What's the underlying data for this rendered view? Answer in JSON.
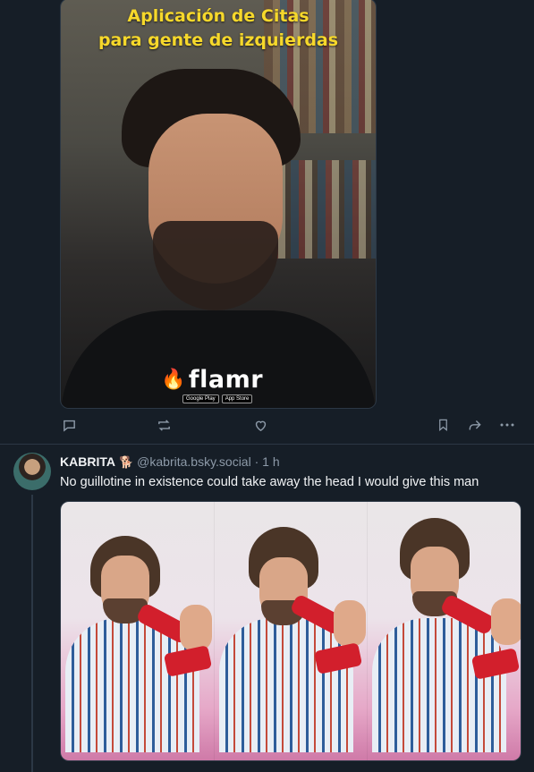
{
  "post1": {
    "image": {
      "title_line1": "Aplicación de Citas",
      "title_line2": "para gente de izquierdas",
      "brand": "flamr",
      "badge_google": "Google Play",
      "badge_apple": "App Store"
    },
    "actions": {
      "reply_icon": "reply-icon",
      "repost_icon": "repost-icon",
      "like_icon": "heart-icon",
      "bookmark_icon": "bookmark-icon",
      "share_icon": "share-icon",
      "more_icon": "more-icon"
    }
  },
  "post2": {
    "author": "KABRITA",
    "emoji": "🐕",
    "handle": "@kabrita.bsky.social",
    "separator": "·",
    "time": "1 h",
    "text": "No guillotine in existence could take away the head I would give this man"
  },
  "colors": {
    "background": "#161e27",
    "text": "#f1f3f5",
    "muted": "#8d9aa8",
    "border": "#2c3845",
    "title_yellow": "#f6d82b"
  }
}
